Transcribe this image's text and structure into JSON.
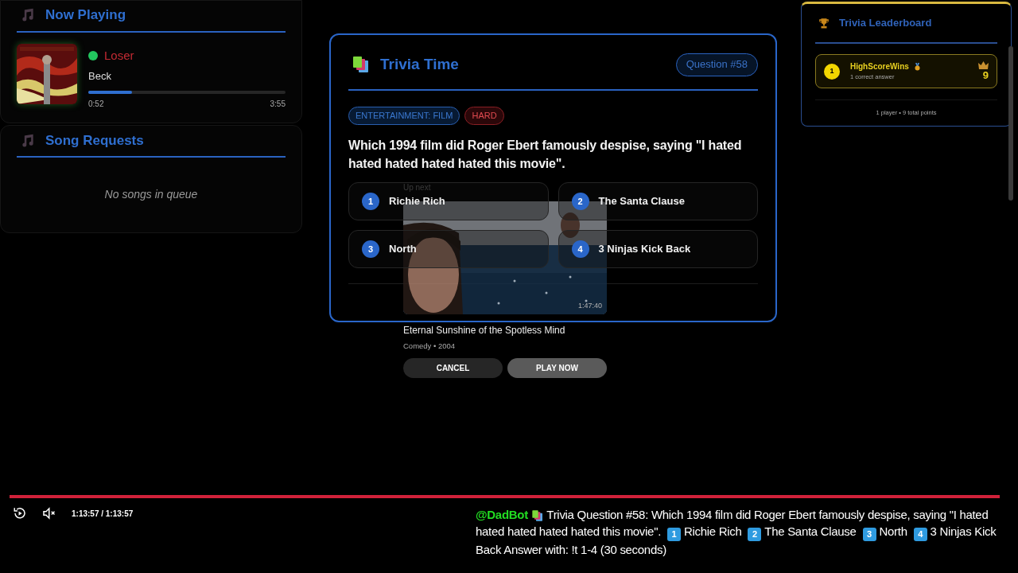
{
  "now_playing": {
    "title": "Now Playing",
    "track": {
      "title": "Loser",
      "artist": "Beck",
      "playing": true,
      "level": 0.22,
      "elapsed": "0:52",
      "duration": "3:55"
    }
  },
  "song_requests": {
    "title": "Song Requests",
    "empty_text": "No songs in queue"
  },
  "trivia": {
    "title": "Trivia Time",
    "question_badge": "Question #58",
    "tags": [
      {
        "label": "ENTERTAINMENT: FILM",
        "kind": "category"
      },
      {
        "label": "HARD",
        "kind": "difficulty"
      }
    ],
    "question": "Which 1994 film did Roger Ebert famously despise, saying \"I hated hated hated hated hated this movie\".",
    "answers": [
      {
        "number": "1",
        "text": "Richie Rich"
      },
      {
        "number": "2",
        "text": "The Santa Clause"
      },
      {
        "number": "3",
        "text": "North"
      },
      {
        "number": "4",
        "text": "3 Ninjas Kick Back"
      }
    ]
  },
  "up_next": {
    "label": "Up next",
    "duration": "1:47:40",
    "title": "Eternal Sunshine of the Spotless Mind",
    "meta": "Comedy • 2004",
    "buttons": [
      {
        "label": "CANCEL",
        "kind": "secondary"
      },
      {
        "label": "PLAY NOW",
        "kind": "primary"
      }
    ]
  },
  "leaderboard": {
    "title": "Trivia Leaderboard",
    "players": [
      {
        "rank": "1",
        "name": "HighScoreWins",
        "detail": "1 correct answer",
        "points": "9"
      }
    ],
    "summary": "1 player • 9 total points"
  },
  "player": {
    "level": 1,
    "time": "1:13:57 / 1:13:57",
    "muted": true
  },
  "chat": {
    "user": "@DadBot",
    "parts": [
      {
        "kind": "text",
        "text": "Trivia Question #58: Which 1994 film did Roger Ebert famously despise, saying \"I hated hated hated hated hated this movie\"."
      },
      {
        "kind": "keycap",
        "text": "1"
      },
      {
        "kind": "text",
        "text": "Richie Rich"
      },
      {
        "kind": "keycap",
        "text": "2"
      },
      {
        "kind": "text",
        "text": "The Santa Clause"
      },
      {
        "kind": "keycap",
        "text": "3"
      },
      {
        "kind": "text",
        "text": "North"
      },
      {
        "kind": "keycap",
        "text": "4"
      },
      {
        "kind": "text",
        "text": "3 Ninjas Kick Back Answer with: !t 1-4 (30 seconds)"
      }
    ]
  }
}
